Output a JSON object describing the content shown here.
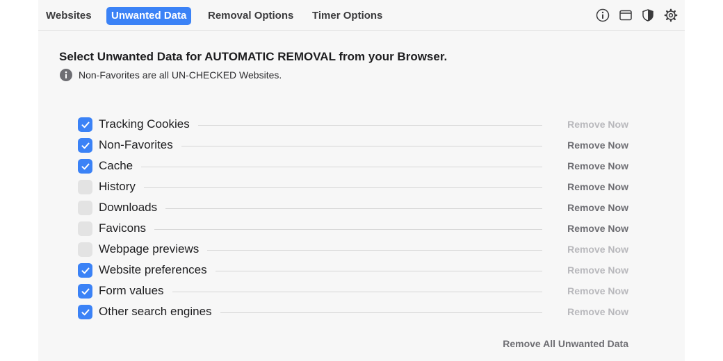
{
  "tabs": [
    {
      "label": "Websites",
      "active": false
    },
    {
      "label": "Unwanted Data",
      "active": true
    },
    {
      "label": "Removal Options",
      "active": false
    },
    {
      "label": "Timer Options",
      "active": false
    }
  ],
  "toolbar_icons": [
    "info-icon",
    "window-icon",
    "shield-icon",
    "gear-icon"
  ],
  "heading": "Select Unwanted Data for AUTOMATIC REMOVAL from your Browser.",
  "note": "Non-Favorites are all UN-CHECKED Websites.",
  "items": [
    {
      "label": "Tracking Cookies",
      "checked": true,
      "action": "Remove Now",
      "action_enabled": false
    },
    {
      "label": "Non-Favorites",
      "checked": true,
      "action": "Remove Now",
      "action_enabled": true
    },
    {
      "label": "Cache",
      "checked": true,
      "action": "Remove Now",
      "action_enabled": true
    },
    {
      "label": "History",
      "checked": false,
      "action": "Remove Now",
      "action_enabled": true
    },
    {
      "label": "Downloads",
      "checked": false,
      "action": "Remove Now",
      "action_enabled": true
    },
    {
      "label": "Favicons",
      "checked": false,
      "action": "Remove Now",
      "action_enabled": true
    },
    {
      "label": "Webpage previews",
      "checked": false,
      "action": "Remove Now",
      "action_enabled": false
    },
    {
      "label": "Website preferences",
      "checked": true,
      "action": "Remove Now",
      "action_enabled": false
    },
    {
      "label": "Form values",
      "checked": true,
      "action": "Remove Now",
      "action_enabled": false
    },
    {
      "label": "Other search engines",
      "checked": true,
      "action": "Remove Now",
      "action_enabled": false
    }
  ],
  "remove_all_label": "Remove All Unwanted Data",
  "colors": {
    "accent": "#3b82f6",
    "panel": "#f7f7f7",
    "disabled_text": "#b8b8bc",
    "enabled_text": "#6e6e73"
  }
}
